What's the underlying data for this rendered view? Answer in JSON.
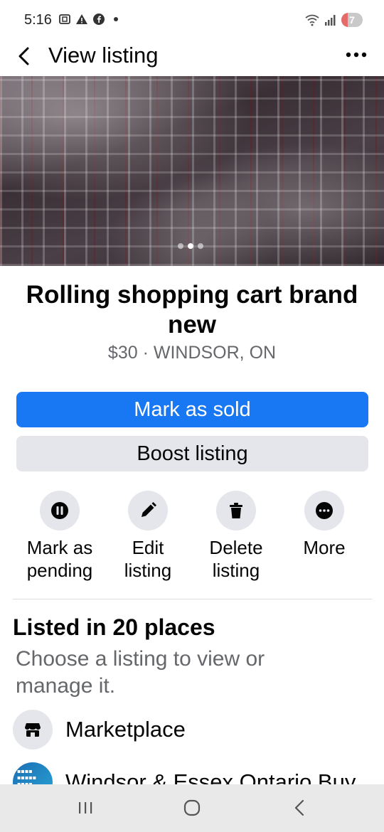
{
  "status_bar": {
    "time": "5:16",
    "battery_level": "7",
    "icons": [
      "screenshot-icon",
      "warning-icon",
      "facebook-messenger-icon",
      "dot-icon",
      "wifi-icon",
      "signal-icon",
      "battery-icon"
    ]
  },
  "header": {
    "title": "View listing",
    "back_icon": "back-arrow-icon",
    "more_icon": "more-horizontal-icon"
  },
  "gallery": {
    "image_count": 3,
    "active_index": 1
  },
  "listing": {
    "title": "Rolling shopping cart brand new",
    "meta": "$30 · WINDSOR, ON"
  },
  "buttons": {
    "mark_sold": "Mark as sold",
    "boost": "Boost listing"
  },
  "actions": [
    {
      "label": "Mark as\npending",
      "icon": "pause-icon"
    },
    {
      "label": "Edit\nlisting",
      "icon": "pencil-icon"
    },
    {
      "label": "Delete\nlisting",
      "icon": "trash-icon"
    },
    {
      "label": "More",
      "icon": "more-icon"
    }
  ],
  "places": {
    "title": "Listed in 20 places",
    "subtitle": "Choose a listing to view or manage it.",
    "items": [
      {
        "label": "Marketplace",
        "icon": "marketplace-store-icon"
      },
      {
        "label": "Windsor & Essex Ontario Buy",
        "icon": "group-avatar"
      }
    ]
  },
  "colors": {
    "primary": "#1877f2",
    "secondary_button": "#e4e6eb",
    "muted_text": "#65676b"
  }
}
